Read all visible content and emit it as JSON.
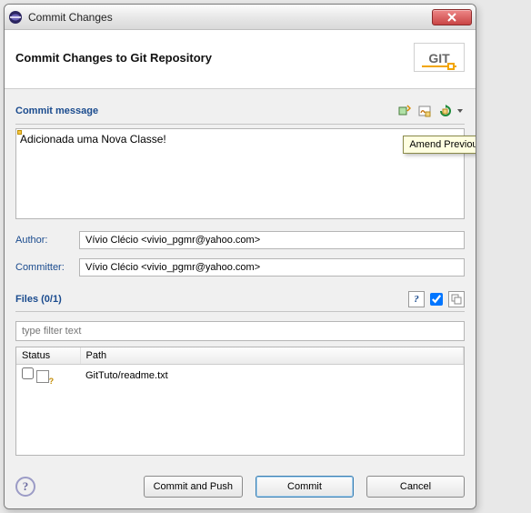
{
  "titlebar": {
    "title": "Commit Changes"
  },
  "header": {
    "title": "Commit Changes to Git Repository",
    "logo_text": "GIT"
  },
  "commit": {
    "section_label": "Commit message",
    "message": "Adicionada uma Nova Classe!",
    "amend_tooltip": "Amend Previous Commit"
  },
  "identity": {
    "author_label": "Author:",
    "author_value": "Vívio Clécio <vivio_pgmr@yahoo.com>",
    "committer_label": "Committer:",
    "committer_value": "Vívio Clécio <vivio_pgmr@yahoo.com>"
  },
  "files": {
    "section_label": "Files (0/1)",
    "filter_placeholder": "type filter text",
    "columns": {
      "status": "Status",
      "path": "Path"
    },
    "rows": [
      {
        "checked": false,
        "path": "GitTuto/readme.txt"
      }
    ]
  },
  "buttons": {
    "commit_push": "Commit and Push",
    "commit": "Commit",
    "cancel": "Cancel"
  }
}
